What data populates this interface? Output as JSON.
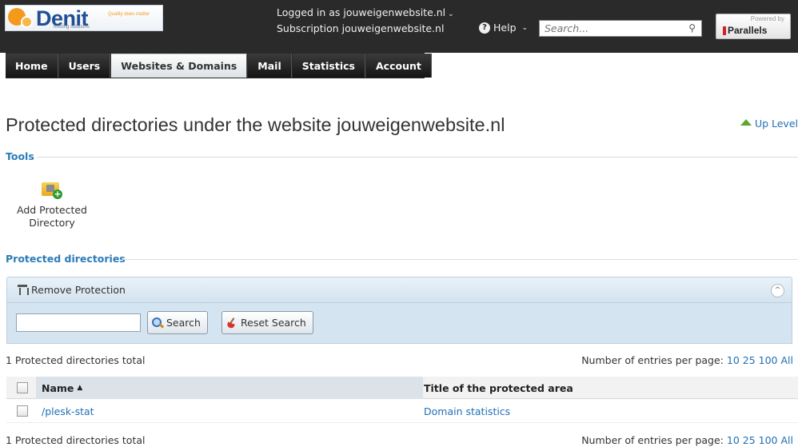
{
  "branding": {
    "logo_name": "Denit",
    "logo_tagline": "Quality does matter",
    "logo_sub": "hosting solutions",
    "powered_by_label": "Powered by",
    "powered_by_name": "Parallels"
  },
  "header": {
    "logged_in_text": "Logged in as  jouweigenwebsite.nl",
    "subscription_text": "Subscription  jouweigenwebsite.nl",
    "help_label": "Help",
    "search_placeholder": "Search..."
  },
  "nav": {
    "tabs": [
      {
        "label": "Home",
        "active": false
      },
      {
        "label": "Users",
        "active": false
      },
      {
        "label": "Websites & Domains",
        "active": true
      },
      {
        "label": "Mail",
        "active": false
      },
      {
        "label": "Statistics",
        "active": false
      },
      {
        "label": "Account",
        "active": false
      }
    ]
  },
  "page": {
    "title": "Protected directories under the website jouweigenwebsite.nl",
    "up_level": "Up Level"
  },
  "tools": {
    "section_label": "Tools",
    "add_protected_directory": "Add Protected Directory"
  },
  "list": {
    "section_label": "Protected directories",
    "remove_protection": "Remove Protection",
    "search_button": "Search",
    "reset_search_button": "Reset Search",
    "total_text": "1 Protected directories total",
    "per_page_label": "Number of entries per page:",
    "per_page_options": [
      "10",
      "25",
      "100",
      "All"
    ],
    "columns": {
      "name": "Name",
      "title": "Title of the protected area"
    },
    "rows": [
      {
        "name": "/plesk-stat",
        "title": "Domain statistics"
      }
    ]
  },
  "colors": {
    "header_bg": "#2a2a2a",
    "link": "#1f6fb5",
    "section_label": "#2a7bb9",
    "panel_bg": "#d4e4f0"
  }
}
